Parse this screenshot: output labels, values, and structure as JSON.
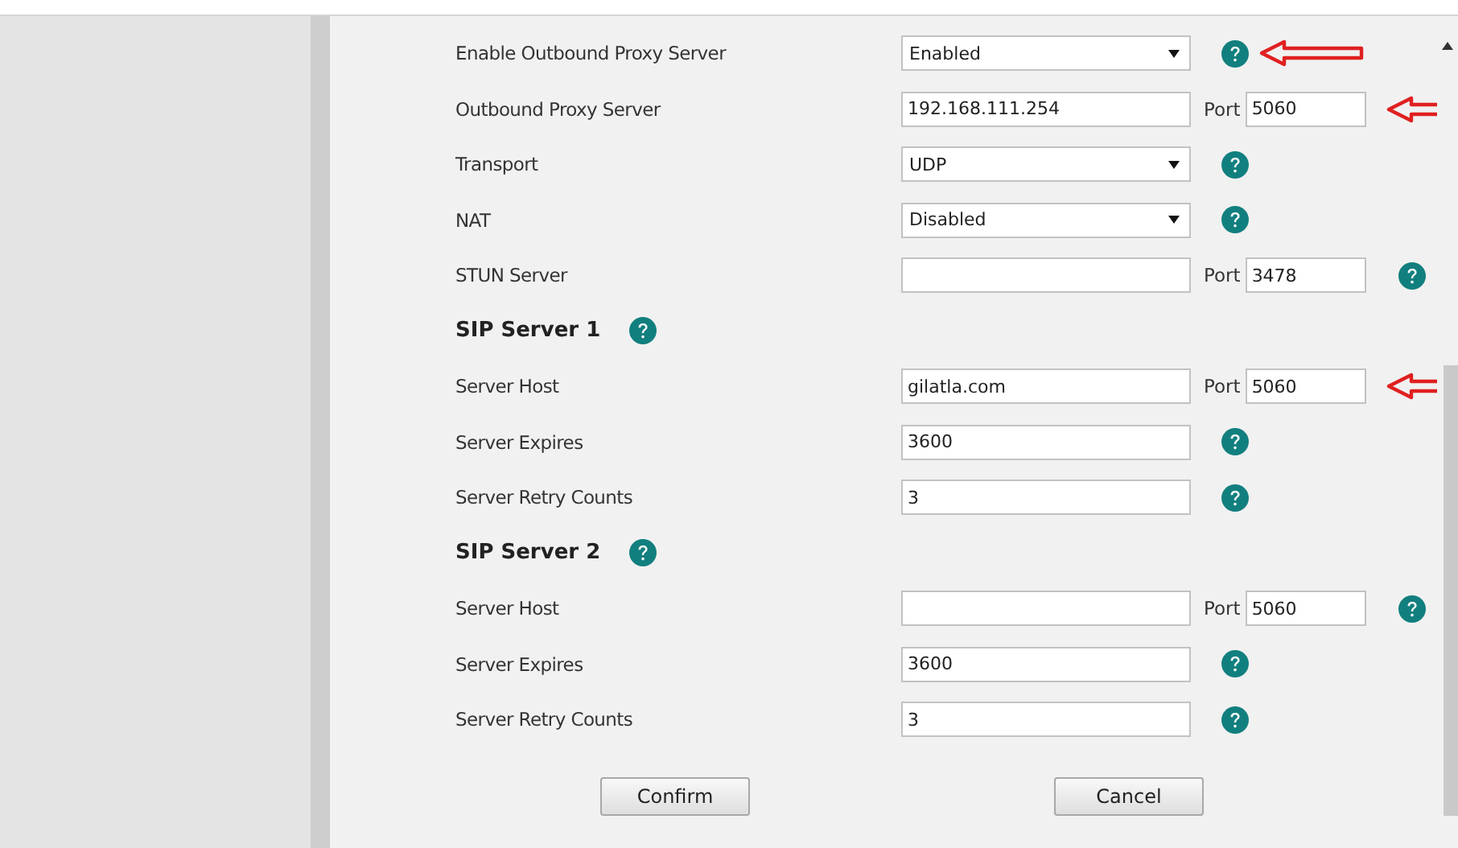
{
  "rows": [
    {
      "kind": "select",
      "label": "Enable Outbound Proxy Server",
      "value": "Enabled",
      "help": true,
      "annotated": true
    },
    {
      "kind": "text_port",
      "label": "Outbound Proxy Server",
      "value": "192.168.111.254",
      "port": "5060",
      "port_label": "Port",
      "help": false,
      "annotated": true
    },
    {
      "kind": "select",
      "label": "Transport",
      "value": "UDP",
      "help": true,
      "annotated": false
    },
    {
      "kind": "select",
      "label": "NAT",
      "value": "Disabled",
      "help": true,
      "annotated": false
    },
    {
      "kind": "text_port",
      "label": "STUN Server",
      "port": "3478",
      "port_label": "Port",
      "help": true,
      "annotated": false
    },
    {
      "kind": "heading",
      "label": "SIP Server 1",
      "help": true
    },
    {
      "kind": "text_port",
      "label": "Server Host",
      "value": "gilatla.com",
      "port": "5060",
      "port_label": "Port",
      "help": false,
      "annotated": true
    },
    {
      "kind": "text",
      "label": "Server Expires",
      "value": "3600",
      "help": true,
      "annotated": false
    },
    {
      "kind": "text",
      "label": "Server Retry Counts",
      "value": "3",
      "help": true,
      "annotated": false
    },
    {
      "kind": "heading",
      "label": "SIP Server 2",
      "help": true
    },
    {
      "kind": "text_port",
      "label": "Server Host",
      "port": "5060",
      "port_label": "Port",
      "help": true,
      "annotated": false
    },
    {
      "kind": "text",
      "label": "Server Expires",
      "value": "3600",
      "help": true,
      "annotated": false
    },
    {
      "kind": "text",
      "label": "Server Retry Counts",
      "value": "3",
      "help": true,
      "annotated": false
    }
  ],
  "buttons": [
    {
      "label": "Confirm"
    },
    {
      "label": "Cancel"
    }
  ]
}
